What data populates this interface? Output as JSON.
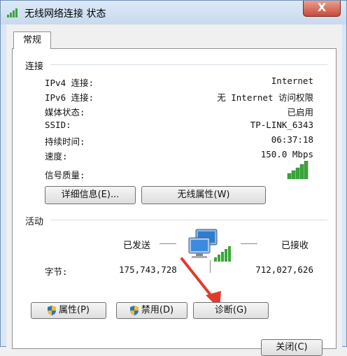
{
  "window": {
    "title": "无线网络连接 状态",
    "close_label": "X"
  },
  "tabs": [
    "常规"
  ],
  "connection": {
    "section_title": "连接",
    "rows": [
      {
        "label": "IPv4 连接:",
        "value": "Internet"
      },
      {
        "label": "IPv6 连接:",
        "value": "无 Internet 访问权限"
      },
      {
        "label": "媒体状态:",
        "value": "已启用"
      },
      {
        "label": "SSID:",
        "value": "TP-LINK_6343"
      },
      {
        "label": "持续时间:",
        "value": "06:37:18"
      },
      {
        "label": "速度:",
        "value": "150.0 Mbps"
      }
    ],
    "signal_label": "信号质量:",
    "signal_bars_lit": 5,
    "signal_bars_total": 5,
    "details_button": "详细信息(E)...",
    "wireless_props_button": "无线属性(W)"
  },
  "activity": {
    "section_title": "活动",
    "sent_label": "已发送",
    "received_label": "已接收",
    "bytes_label": "字节:",
    "bytes_sent": "175,743,728",
    "bytes_received": "712,027,626"
  },
  "buttons": {
    "properties": "属性(P)",
    "disable": "禁用(D)",
    "diagnose": "诊断(G)",
    "close": "关闭(C)"
  },
  "colors": {
    "signal_green": "#3aa53a",
    "arrow_red": "#e03a2c"
  }
}
